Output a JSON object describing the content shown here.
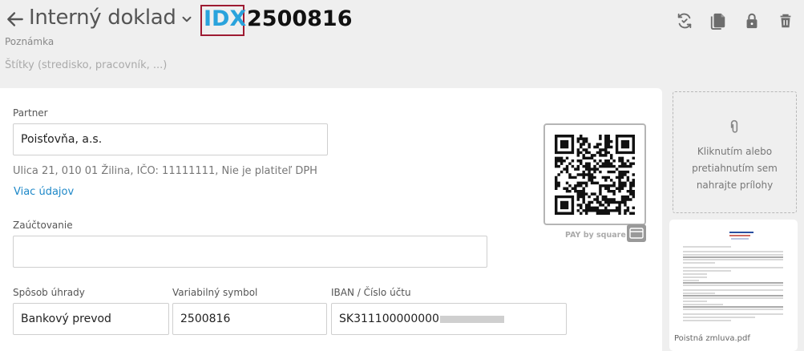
{
  "header": {
    "title": "Interný doklad",
    "prefix": "IDX",
    "number": "2500816",
    "note": "Poznámka",
    "tags_placeholder": "Štítky (stredisko, pracovník, ...)"
  },
  "toolbar": {
    "icons": [
      "sync-icon",
      "copy-icon",
      "lock-icon",
      "delete-icon"
    ]
  },
  "form": {
    "partner_label": "Partner",
    "partner_value": "Poisťovňa, a.s.",
    "address": "Ulica 21, 010 01 Žilina, IČO: 11111111, Nie je platiteľ DPH",
    "more_link": "Viac údajov",
    "posting_label": "Zaúčtovanie",
    "posting_value": "",
    "payment_label": "Spôsob úhrady",
    "payment_value": "Bankový prevod",
    "vs_label": "Variabilný symbol",
    "vs_value": "2500816",
    "iban_label": "IBAN / Číslo účtu",
    "iban_value": "SK311100000000"
  },
  "qr": {
    "caption": "PAY by square"
  },
  "attachments": {
    "drop_text": [
      "Kliknutím alebo",
      "pretiahnutím sem",
      "nahrajte prílohy"
    ],
    "file_name": "Poistná zmluva.pdf"
  },
  "colors": {
    "accent": "#2aa3dc",
    "highlight_border": "#9e1b32",
    "link": "#1e88c8"
  }
}
